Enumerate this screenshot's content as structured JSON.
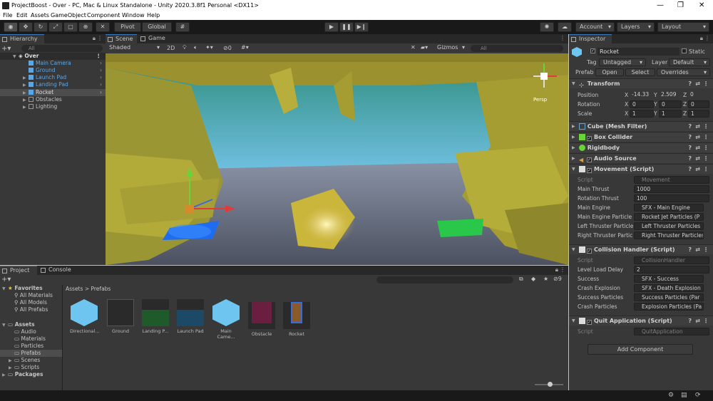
{
  "window": {
    "title": "ProjectBoost - Over - PC, Mac & Linux Standalone - Unity 2020.3.8f1 Personal <DX11>"
  },
  "menu": [
    "File",
    "Edit",
    "Assets",
    "GameObject",
    "Component",
    "Window",
    "Help"
  ],
  "toolbar": {
    "pivot": "Pivot",
    "global": "Global",
    "account": "Account",
    "layers": "Layers",
    "layout": "Layout"
  },
  "hierarchy": {
    "tab": "Hierarchy",
    "search_placeholder": "All",
    "scene": "Over",
    "items": [
      "Main Camera",
      "Ground",
      "Launch Pad",
      "Landing Pad",
      "Rocket",
      "Obstacles",
      "Lighting"
    ]
  },
  "scene_view": {
    "tab_scene": "Scene",
    "tab_game": "Game",
    "shading": "Shaded",
    "mode_2d": "2D",
    "gizmos": "Gizmos",
    "search": "All",
    "persp": "Persp",
    "effects_count": "0"
  },
  "project": {
    "tab_project": "Project",
    "tab_console": "Console",
    "breadcrumb_root": "Assets",
    "breadcrumb_sep": ">",
    "breadcrumb_leaf": "Prefabs",
    "favorites": "Favorites",
    "fav_items": [
      "All Materials",
      "All Models",
      "All Prefabs"
    ],
    "assets": "Assets",
    "asset_folders": [
      "Audio",
      "Materials",
      "Particles",
      "Prefabs",
      "Scenes",
      "Scripts"
    ],
    "packages": "Packages",
    "hidden_count": "9",
    "prefabs": [
      {
        "label": "Directional...",
        "color": "#6ec6f0"
      },
      {
        "label": "Ground",
        "color": "#3a3a3a"
      },
      {
        "label": "Landing P...",
        "color": "#1f5a2a"
      },
      {
        "label": "Launch Pad",
        "color": "#1c4a66"
      },
      {
        "label": "Main Came...",
        "color": "#6ec6f0"
      },
      {
        "label": "Obstacle",
        "color": "#6b1f40"
      },
      {
        "label": "Rocket",
        "color": "#8a5a2a"
      }
    ]
  },
  "inspector": {
    "tab": "Inspector",
    "name": "Rocket",
    "static": "Static",
    "tag_label": "Tag",
    "tag": "Untagged",
    "layer_label": "Layer",
    "layer": "Default",
    "prefab_label": "Prefab",
    "open": "Open",
    "select": "Select",
    "overrides": "Overrides",
    "transform": {
      "title": "Transform",
      "position": "Position",
      "rotation": "Rotation",
      "scale": "Scale",
      "pos": [
        "-14.33",
        "2.509",
        "0"
      ],
      "rot": [
        "0",
        "0",
        "0"
      ],
      "scl": [
        "1",
        "1",
        "1"
      ]
    },
    "mesh_filter": "Cube (Mesh Filter)",
    "box_collider": "Box Collider",
    "rigidbody": "Rigidbody",
    "audio_source": "Audio Source",
    "movement": {
      "title": "Movement (Script)",
      "script_label": "Script",
      "script": "Movement",
      "fields": [
        {
          "label": "Main Thrust",
          "value": "1000"
        },
        {
          "label": "Rotation Thrust",
          "value": "100"
        },
        {
          "label": "Main Engine",
          "value": "SFX - Main Engine"
        },
        {
          "label": "Main Engine Particle",
          "value": "Rocket Jet Particles (P"
        },
        {
          "label": "Left Thruster Particle",
          "value": "Left Thruster Particles"
        },
        {
          "label": "Right Thruster Partic",
          "value": "Right Thruster Particles"
        }
      ]
    },
    "collision": {
      "title": "Collision Handler (Script)",
      "script_label": "Script",
      "script": "CollisionHandler",
      "fields": [
        {
          "label": "Level Load Delay",
          "value": "2"
        },
        {
          "label": "Success",
          "value": "SFX - Success"
        },
        {
          "label": "Crash Explosion",
          "value": "SFX - Death Explosion"
        },
        {
          "label": "Success Particles",
          "value": "Success Particles (Par"
        },
        {
          "label": "Crash Particles",
          "value": "Explosion Particles (Pa"
        }
      ]
    },
    "quit": {
      "title": "Quit Application (Script)",
      "script_label": "Script",
      "script": "QuitApplication"
    },
    "add_component": "Add Component"
  },
  "axis_labels": {
    "x": "X",
    "y": "Y",
    "z": "Z"
  }
}
